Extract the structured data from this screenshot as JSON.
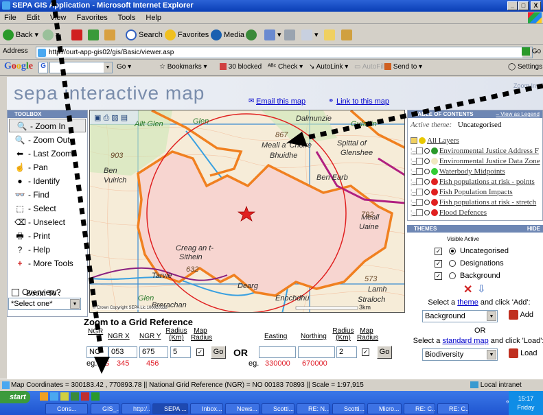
{
  "window": {
    "title": "SEPA GIS Application - Microsoft Internet Explorer",
    "min": "_",
    "max": "□",
    "close": "X"
  },
  "menu": [
    "File",
    "Edit",
    "View",
    "Favorites",
    "Tools",
    "Help"
  ],
  "toolbar": {
    "back": "Back",
    "search": "Search",
    "favorites": "Favorites",
    "media": "Media"
  },
  "address": {
    "label": "Address",
    "url": "http://ourt-app-gis02/gis/Basic/viewer.asp",
    "go": "Go"
  },
  "google": {
    "logo": "Google",
    "input_value": "G",
    "go": "Go",
    "bookmarks": "Bookmarks",
    "blocked": "30 blocked",
    "check": "Check",
    "autolink": "AutoLink",
    "autofill": "AutoFill",
    "sendto": "Send to",
    "settings": "Settings"
  },
  "header": {
    "logo_text": "sepa interactive map",
    "zoom_hint": "Zoom In",
    "email_link": "Email this map",
    "link_link": "Link to this map"
  },
  "toolbox": {
    "title": "TOOLBOX",
    "tools": [
      {
        "label": "- Zoom In",
        "icon": "zoom-in-icon",
        "glyph": "🔍"
      },
      {
        "label": "- Zoom Out",
        "icon": "zoom-out-icon",
        "glyph": "🔍"
      },
      {
        "label": "- Last Zoom",
        "icon": "arrow-left-icon",
        "glyph": "⬅"
      },
      {
        "label": "- Pan",
        "icon": "hand-icon",
        "glyph": "☝"
      },
      {
        "label": "- Identify",
        "icon": "info-icon",
        "glyph": "●"
      },
      {
        "label": "- Find",
        "icon": "binoculars-icon",
        "glyph": "👓"
      },
      {
        "label": "- Select",
        "icon": "select-icon",
        "glyph": "⬚"
      },
      {
        "label": "- Unselect",
        "icon": "eraser-icon",
        "glyph": "⌫"
      },
      {
        "label": "- Print",
        "icon": "printer-icon",
        "glyph": "🖶"
      },
      {
        "label": "- Help",
        "icon": "help-icon",
        "glyph": "?"
      },
      {
        "label": "- More Tools",
        "icon": "plus-icon",
        "glyph": "+"
      }
    ],
    "overview_label": "Overview?",
    "zoom_to_label": "Zoom To :",
    "zoom_to_select": "*Select one*"
  },
  "map": {
    "place_labels": [
      "Dalmunzie",
      "867",
      "Meall a' Choire",
      "Bhuidhe",
      "Spittal of",
      "Glenshee",
      "Ben",
      "Vuirich",
      "Ben Earb",
      "Creag an t-",
      "Sithein",
      "632",
      "Meall",
      "Uaine",
      "573",
      "Lamh",
      "Dearg",
      "Straloch",
      "Glen",
      "Brerachan",
      "Enochdhu",
      "Tarvie",
      "903",
      "792",
      "Allt Glen",
      "Gulabin",
      "Glen",
      "ar"
    ],
    "copyright": "© Crown Copyright SEPA Lic 100020538",
    "scale_label": "3km"
  },
  "toc": {
    "title": "TABLE OF CONTENTS",
    "view_legend": "View as Legend",
    "active_theme_label": "Active theme:",
    "active_theme_value": "Uncategorised",
    "layers": [
      {
        "label": "All Layers",
        "color": "#e8c800"
      },
      {
        "label": "Environmental Justice Address F",
        "color": "#2a9a2a"
      },
      {
        "label": "Environmental Justice Data Zone",
        "color": "#f0e8c0"
      },
      {
        "label": "Waterbody Midpoints",
        "color": "#33cc33"
      },
      {
        "label": "Fish populations at risk - points",
        "color": "#e02020"
      },
      {
        "label": "Fish Population Impacts",
        "color": "#e02020"
      },
      {
        "label": "Fish populations at risk - stretch",
        "color": "#e02020"
      },
      {
        "label": "Flood Defences",
        "color": "#e02020"
      }
    ]
  },
  "themes": {
    "title": "THEMES",
    "hide": "HIDE",
    "visible_active": "Visible Active",
    "options": [
      "Uncategorised",
      "Designations",
      "Background"
    ],
    "select_theme_text": "Select a",
    "theme_link": "theme",
    "select_theme_suffix": "and click 'Add':",
    "theme_select_value": "Background",
    "add_label": "Add",
    "or": "OR",
    "select_map_text": "Select a",
    "map_link": "standard map",
    "select_map_suffix": "and click 'Load':",
    "map_select_value": "Biodiversity",
    "load_label": "Load"
  },
  "gridref": {
    "title": "Zoom to a Grid Reference",
    "ngr": "NGR",
    "ngr_x": "NGR X",
    "ngr_y": "NGR Y",
    "radius_km": "Radius (Km)",
    "map_radius": "Map Radius",
    "ngr_value": "NO",
    "x_value": "053",
    "y_value": "675",
    "radius_value": "5",
    "go": "Go",
    "or": "OR",
    "easting": "Easting",
    "northing": "Northing",
    "radius_value2": "2",
    "eg1": "eg.",
    "eg_ngr": "NS",
    "eg_x": "345",
    "eg_y": "456",
    "eg2": "eg.",
    "eg_easting": "330000",
    "eg_northing": "670000"
  },
  "status": {
    "text": "Map Coordinates = 300183.42 , 770893.78  ||  National Grid Reference (NGR) = NO 00183 70893  ||  Scale = 1:97,915",
    "zone": "Local intranet"
  },
  "taskbar": {
    "start": "start",
    "tasks": [
      "Cons...",
      "GIS_...",
      "http:/...",
      "SEPA ...",
      "Inbox...",
      "News...",
      "Scotti...",
      "RE: N...",
      "Scotti...",
      "Micro...",
      "RE: C...",
      "RE: C..."
    ],
    "time": "15:17",
    "day": "Friday"
  },
  "colors": {
    "accent": "#6e87b4",
    "orange_boundary": "#f08020",
    "red_circle": "#e02020"
  }
}
